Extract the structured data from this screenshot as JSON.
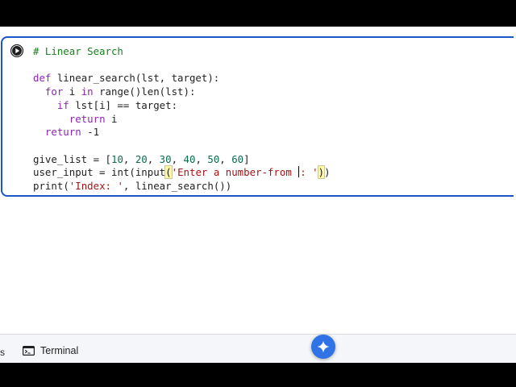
{
  "code": {
    "comment": "# Linear Search",
    "kw_def": "def",
    "func_sig": " linear_search(lst, target):",
    "kw_for": "for",
    "for_mid": " i ",
    "kw_in": "in",
    "for_a": " range(",
    "for_b": ")len(lst):",
    "kw_if": "if",
    "if_rest": " lst[i] == target:",
    "kw_return1": "return",
    "return1_rest": " i",
    "kw_return2": "return",
    "return2_rest": " -1",
    "list_name": "give_list = [",
    "n1": "10",
    "n2": "20",
    "n3": "30",
    "n4": "40",
    "n5": "50",
    "n6": "60",
    "list_sep": ", ",
    "list_close": "]",
    "input_a": "user_input = ",
    "input_int": "int",
    "input_b": "(input",
    "input_paren": "(",
    "input_str1": "'Enter a number-from ",
    "input_str2": ": '",
    "input_paren_close": ")",
    "input_end": ")",
    "print_a": "print",
    "print_b": "(",
    "print_str": "'Index: '",
    "print_c": ", linear_search())"
  },
  "statusbar": {
    "partial_label": "s",
    "terminal_label": "Terminal"
  },
  "icons": {
    "run": "play-circle-icon",
    "terminal": "terminal-icon",
    "gemini": "sparkle-icon"
  },
  "colors": {
    "cell_border": "#1a56c8",
    "gemini_button": "#2f73e6"
  }
}
